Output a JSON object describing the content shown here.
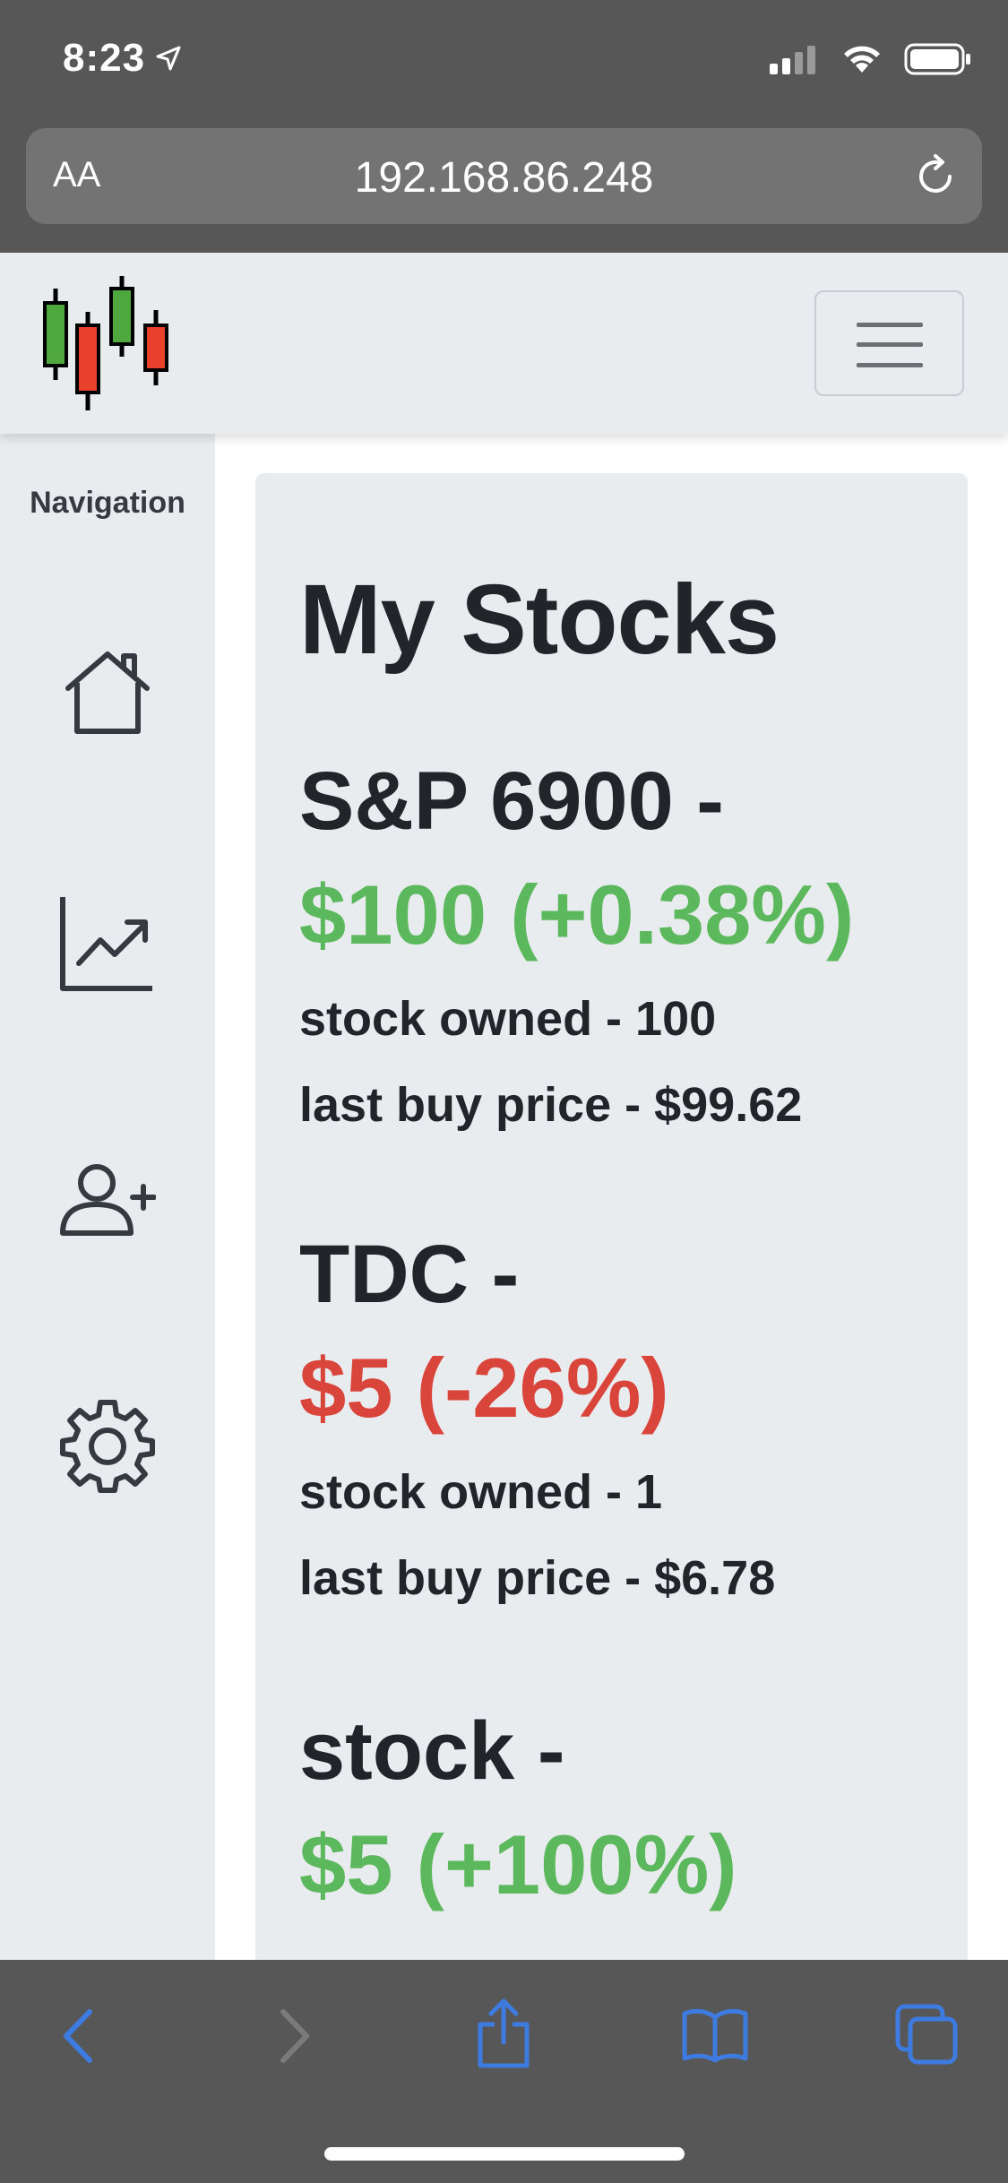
{
  "status_bar": {
    "time": "8:23",
    "location_icon": "location-arrow-icon",
    "signal_icon": "cellular-signal-icon",
    "wifi_icon": "wifi-icon",
    "battery_icon": "battery-icon"
  },
  "address_bar": {
    "text_size_label": "AA",
    "url": "192.168.86.248",
    "reload_icon": "reload-icon"
  },
  "navbar": {
    "logo_icon": "candlestick-logo-icon",
    "toggler_icon": "hamburger-menu-icon"
  },
  "sidebar": {
    "title": "Navigation",
    "items": [
      {
        "icon": "home-icon"
      },
      {
        "icon": "chart-line-icon"
      },
      {
        "icon": "add-user-icon"
      },
      {
        "icon": "gear-icon"
      }
    ]
  },
  "main": {
    "title": "My Stocks",
    "stocks": [
      {
        "name": "S&P 6900 -",
        "price": "$100 (+0.38%)",
        "trend": "up",
        "owned": "stock owned - 100",
        "last_buy": "last buy price - $99.62"
      },
      {
        "name": "TDC -",
        "price": "$5 (-26%)",
        "trend": "down",
        "owned": "stock owned - 1",
        "last_buy": "last buy price - $6.78"
      },
      {
        "name": "stock -",
        "price": "$5 (+100%)",
        "trend": "up"
      }
    ]
  },
  "colors": {
    "up": "#5cb85c",
    "down": "#d9443b",
    "toolbar_accent": "#3d7be0",
    "chrome_bg": "#575757",
    "panel_bg": "#e9ecef"
  },
  "toolbar": {
    "icons": [
      "back-icon",
      "forward-icon",
      "share-icon",
      "bookmarks-icon",
      "tabs-icon"
    ]
  }
}
